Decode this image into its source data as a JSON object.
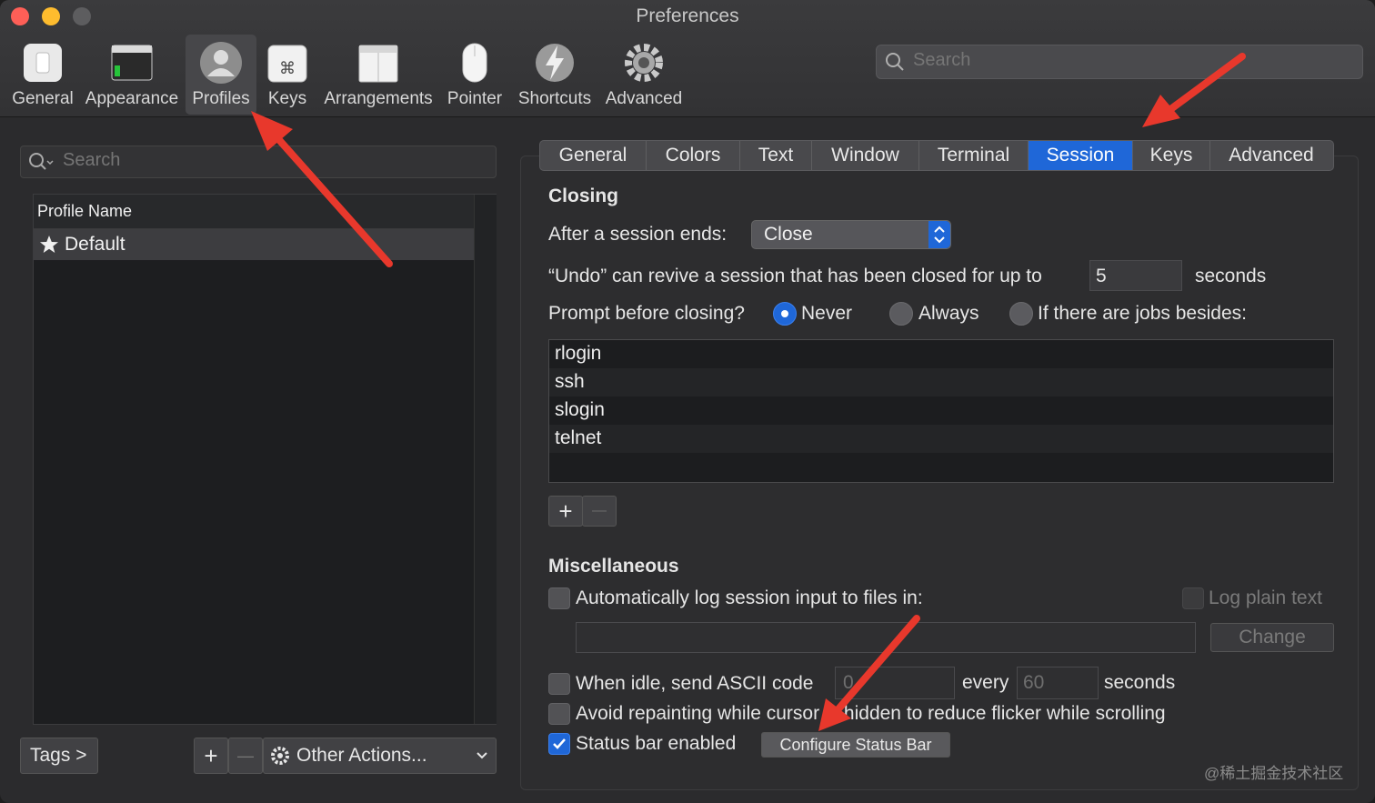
{
  "window": {
    "title": "Preferences"
  },
  "toolbar": {
    "items": [
      {
        "label": "General"
      },
      {
        "label": "Appearance"
      },
      {
        "label": "Profiles"
      },
      {
        "label": "Keys"
      },
      {
        "label": "Arrangements"
      },
      {
        "label": "Pointer"
      },
      {
        "label": "Shortcuts"
      },
      {
        "label": "Advanced"
      }
    ],
    "selected": "Profiles",
    "search_placeholder": "Search"
  },
  "profiles_pane": {
    "search_placeholder": "Search",
    "column_header": "Profile Name",
    "profiles": [
      {
        "name": "Default",
        "is_default": true
      }
    ],
    "tags_button": "Tags >",
    "add_label": "+",
    "remove_label": "—",
    "other_actions": "Other Actions..."
  },
  "tabs": {
    "items": [
      "General",
      "Colors",
      "Text",
      "Window",
      "Terminal",
      "Session",
      "Keys",
      "Advanced"
    ],
    "active": "Session"
  },
  "closing": {
    "heading": "Closing",
    "after_session_label": "After a session ends:",
    "after_session_value": "Close",
    "undo_prefix": "“Undo” can revive a session that has been closed for up to",
    "undo_seconds": "5",
    "undo_suffix": "seconds",
    "prompt_label": "Prompt before closing?",
    "prompt_options": [
      "Never",
      "Always",
      "If there are jobs besides:"
    ],
    "prompt_selected": "Never",
    "jobs": [
      "rlogin",
      "ssh",
      "slogin",
      "telnet"
    ],
    "add_label": "+",
    "remove_label": "—"
  },
  "misc": {
    "heading": "Miscellaneous",
    "auto_log_label": "Automatically log session input to files in:",
    "auto_log_checked": false,
    "log_plain_text": "Log plain text",
    "change_button": "Change",
    "idle_label": "When idle, send ASCII code",
    "idle_code": "0",
    "every_label": "every",
    "every_value": "60",
    "seconds_label": "seconds",
    "idle_checked": false,
    "avoid_repaint_label": "Avoid repainting while cursor is hidden to reduce flicker while scrolling",
    "avoid_repaint_checked": false,
    "status_bar_label": "Status bar enabled",
    "status_bar_checked": true,
    "configure_button": "Configure Status Bar"
  },
  "watermark": "@稀土掘金技术社区",
  "colors": {
    "accent": "#1f67d8",
    "annotation_arrow": "#e8382c"
  }
}
